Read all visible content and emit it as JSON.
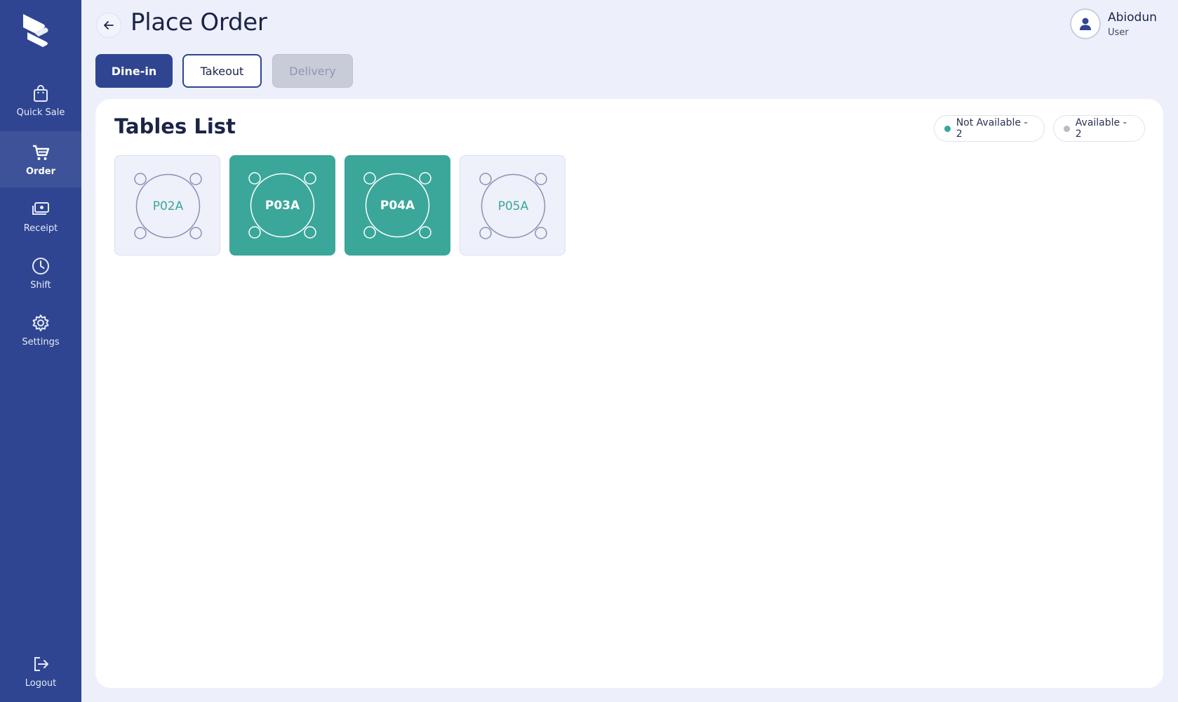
{
  "sidebar": {
    "items": [
      {
        "label": "Quick Sale",
        "icon": "bag-icon"
      },
      {
        "label": "Order",
        "icon": "cart-icon",
        "active": true
      },
      {
        "label": "Receipt",
        "icon": "money-icon"
      },
      {
        "label": "Shift",
        "icon": "clock-icon"
      },
      {
        "label": "Settings",
        "icon": "gear-icon"
      }
    ],
    "logout": {
      "label": "Logout",
      "icon": "logout-icon"
    }
  },
  "header": {
    "title": "Place Order",
    "user": {
      "name": "Abiodun",
      "role": "User"
    }
  },
  "order_types": [
    {
      "label": "Dine-in",
      "state": "selected"
    },
    {
      "label": "Takeout",
      "state": "default"
    },
    {
      "label": "Delivery",
      "state": "disabled"
    }
  ],
  "tables_panel": {
    "title": "Tables List",
    "legend": [
      {
        "label": "Not Available - 2",
        "color": "#3aa79a"
      },
      {
        "label": "Available - 2",
        "color": "#b8bcc8"
      }
    ],
    "tables": [
      {
        "name": "P02A",
        "status": "available"
      },
      {
        "name": "P03A",
        "status": "not_available"
      },
      {
        "name": "P04A",
        "status": "not_available"
      },
      {
        "name": "P05A",
        "status": "available"
      }
    ]
  },
  "colors": {
    "sidebar": "#2f4591",
    "accent": "#3aa79a",
    "background": "#edf0fb"
  }
}
